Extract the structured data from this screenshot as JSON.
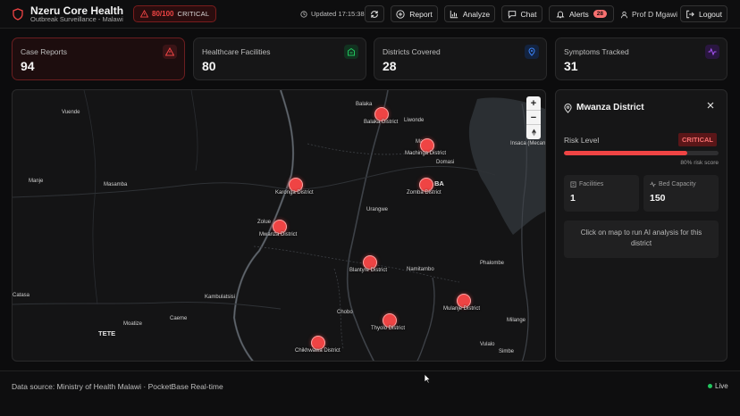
{
  "header": {
    "title": "Nzeru Core Health",
    "subtitle": "Outbreak Surveillance - Malawi",
    "risk_score": "80/100",
    "risk_level": "CRITICAL",
    "updated": "Updated 17:15:38",
    "buttons": {
      "report": "Report",
      "analyze": "Analyze",
      "chat": "Chat",
      "alerts": "Alerts",
      "alerts_count": "28",
      "logout": "Logout"
    },
    "user": "Prof D Mgawi"
  },
  "stats": [
    {
      "label": "Case Reports",
      "value": "94",
      "icon": "warning-triangle-icon",
      "color": "#ef4444"
    },
    {
      "label": "Healthcare Facilities",
      "value": "80",
      "icon": "hospital-building-icon",
      "color": "#22c55e"
    },
    {
      "label": "Districts Covered",
      "value": "28",
      "icon": "map-pin-icon",
      "color": "#3b82f6"
    },
    {
      "label": "Symptoms Tracked",
      "value": "31",
      "icon": "activity-pulse-icon",
      "color": "#a855f7"
    }
  ],
  "map": {
    "places": [
      "Balaka",
      "Liwonde",
      "Vuende",
      "Manje",
      "Masamba",
      "Domasi",
      "Insaca (Mecan",
      "Urangwe",
      "Namitambo",
      "Phalombe",
      "Catasa",
      "Kambulatsisi",
      "Chobo",
      "Moatize",
      "Caeme",
      "Milange",
      "Vulalo",
      "Simbe",
      "Zolue",
      "Mango"
    ],
    "big_places": [
      "TETE",
      "BA"
    ],
    "markers": [
      {
        "label": "Balaka District"
      },
      {
        "label": "Machinga District"
      },
      {
        "label": "Karonga District"
      },
      {
        "label": "Zomba District"
      },
      {
        "label": "Mwanza District"
      },
      {
        "label": "Blantyre District"
      },
      {
        "label": "Mulanje District"
      },
      {
        "label": "Thyolo District"
      },
      {
        "label": "Chikhwawa District"
      }
    ],
    "zoom_in": "+",
    "zoom_out": "−"
  },
  "panel": {
    "title": "Mwanza District",
    "risk_label": "Risk Level",
    "risk_badge": "CRITICAL",
    "risk_percent": 80,
    "risk_text": "80% risk score",
    "facilities_label": "Facilities",
    "facilities_value": "1",
    "beds_label": "Bed Capacity",
    "beds_value": "150",
    "hint": "Click on map to run AI analysis for this district"
  },
  "footer": {
    "source": "Data source: Ministry of Health Malawi · PocketBase Real-time",
    "live": "Live"
  }
}
